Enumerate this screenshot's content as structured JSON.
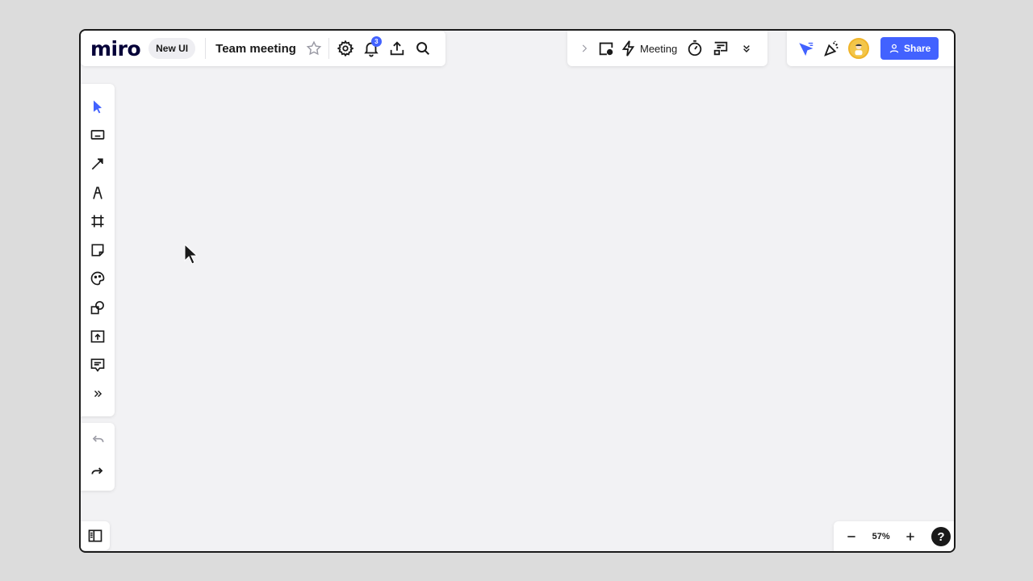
{
  "app": {
    "logo": "miro",
    "ui_badge": "New UI",
    "board_title": "Team meeting"
  },
  "topbar": {
    "notifications_count": "3",
    "meeting_label": "Meeting",
    "share_label": "Share"
  },
  "zoom": {
    "value": "57%"
  },
  "help": {
    "label": "?"
  },
  "colors": {
    "accent": "#4262ff",
    "canvas": "#f2f2f4",
    "ink": "#1a1a1a"
  },
  "toolbar": {
    "tools": [
      "select-icon",
      "text-icon",
      "line-icon",
      "pen-icon",
      "frame-icon",
      "sticky-note-icon",
      "sticker-icon",
      "shapes-icon",
      "upload-icon",
      "comment-icon",
      "more-tools-icon"
    ]
  }
}
